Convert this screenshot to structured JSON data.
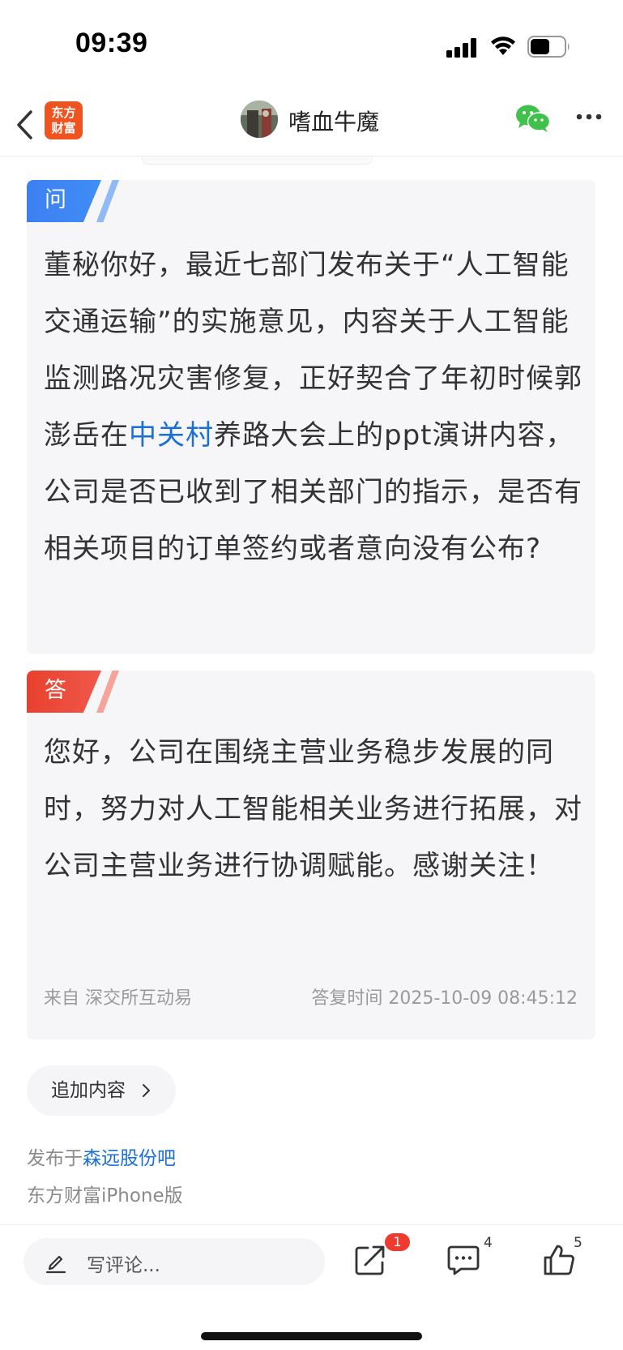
{
  "status_bar": {
    "time": "09:39"
  },
  "nav": {
    "logo_line1": "东方",
    "logo_line2": "财富",
    "user_name": "嗜血牛魔"
  },
  "question": {
    "tag": "问",
    "text_before_link": "董秘你好，最近七部门发布关于“人工智能 交通运输”的实施意见，内容关于人工智能监测路况灾害修复，正好契合了年初时候郭澎岳在",
    "link_text": "中关村",
    "text_after_link": "养路大会上的ppt演讲内容，公司是否已收到了相关部门的指示，是否有相关项目的订单签约或者意向没有公布?"
  },
  "answer": {
    "tag": "答",
    "text": "您好，公司在围绕主营业务稳步发展的同时，努力对人工智能相关业务进行拓展，对公司主营业务进行协调赋能。感谢关注！",
    "source": "来自  深交所互动易",
    "reply_time": "答复时间  2025-10-09 08:45:12"
  },
  "add_content": {
    "label": "追加内容"
  },
  "publish": {
    "prefix": "发布于",
    "forum": "森远股份吧",
    "platform": "东方财富iPhone版"
  },
  "bottom_bar": {
    "comment_placeholder": "写评论...",
    "share_badge": "1",
    "comment_count": "4",
    "like_count": "5"
  },
  "colors": {
    "accent_blue": "#1a6fd6",
    "question_tag": "#3d7ff2",
    "answer_tag": "#e8412e",
    "logo_orange": "#f0531f",
    "badge_red": "#ee3a2f"
  }
}
